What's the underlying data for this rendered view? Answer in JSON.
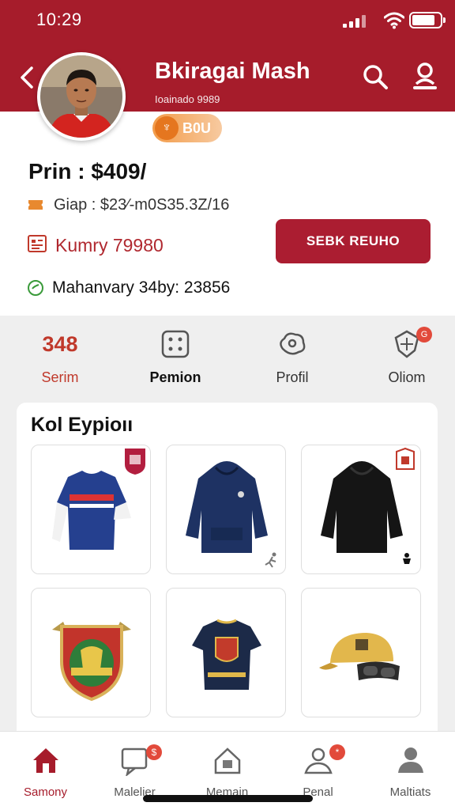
{
  "status_bar": {
    "time": "10:29"
  },
  "header": {
    "name": "Bkiragai Mash",
    "subtitle": "Ioainado 9989",
    "icons": [
      "back-icon",
      "search-icon",
      "user-icon"
    ]
  },
  "info": {
    "pill_label": "B0U",
    "price": "Prin : $409/",
    "row2": "Giap  :  $23⁄-m0S35.3Z/16",
    "row3": "Kumry 79980",
    "cta": "SEBK REUHO",
    "row4": "Mahanvary 34by: 23856"
  },
  "stats": [
    {
      "value": "348",
      "label": "Serim",
      "icon": ""
    },
    {
      "value": "",
      "label": "Pemion",
      "icon": "dice-icon"
    },
    {
      "value": "",
      "label": "Profil",
      "icon": "blob-icon"
    },
    {
      "value": "",
      "label": "Oliom",
      "icon": "shield-icon",
      "badge": "G"
    }
  ],
  "panel": {
    "title": "Kol Eypioıı",
    "products": [
      "jersey",
      "navy-hoodie",
      "black-hoodie",
      "crest-badge",
      "tshirt",
      "cap-goggles"
    ]
  },
  "nav": [
    {
      "label": "Samony",
      "icon": "home-icon",
      "active": true
    },
    {
      "label": "Malelier",
      "icon": "chat-icon",
      "badge": "$"
    },
    {
      "label": "Memain",
      "icon": "house-icon"
    },
    {
      "label": "Penal",
      "icon": "person-icon",
      "badge": "*"
    },
    {
      "label": "Maltiats",
      "icon": "profile-icon"
    }
  ],
  "colors": {
    "brand": "#a61c2b",
    "accent": "#e5761f"
  }
}
